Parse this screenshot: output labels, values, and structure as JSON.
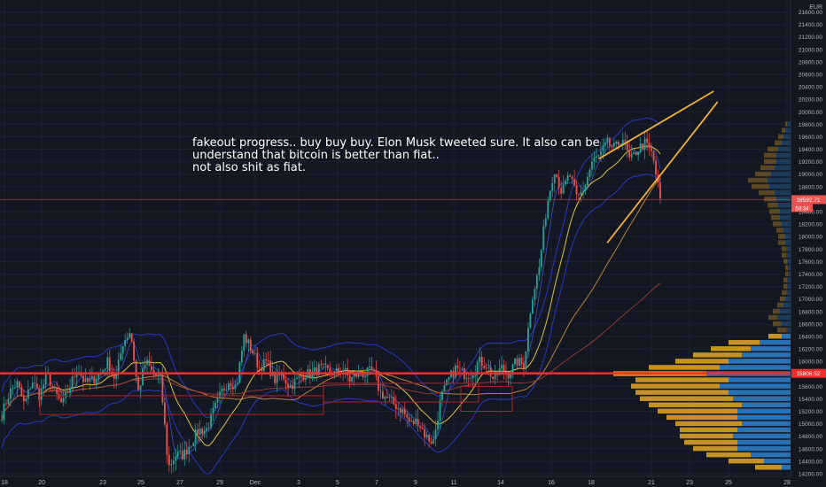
{
  "chart_data": {
    "type": "candlestick",
    "currency": "EUR",
    "y_axis": {
      "min": 14200,
      "max": 21600,
      "ticks": [
        14200,
        14400,
        14600,
        14800,
        15000,
        15200,
        15400,
        15600,
        15800,
        16000,
        16200,
        16400,
        16600,
        16800,
        17000,
        17200,
        17400,
        17600,
        17800,
        18000,
        18200,
        18400,
        18600,
        18800,
        19000,
        19200,
        19400,
        19600,
        19800,
        20000,
        20200,
        20400,
        20600,
        20800,
        21000,
        21200,
        21400,
        21600
      ],
      "tick_labels": [
        "14200.00",
        "14400.00",
        "14600.00",
        "14800.00",
        "15000.00",
        "15200.00",
        "15400.00",
        "15600.00",
        "15800.00",
        "16000.00",
        "16200.00",
        "16400.00",
        "16600.00",
        "16800.00",
        "17000.00",
        "17200.00",
        "17400.00",
        "17600.00",
        "17800.00",
        "18000.00",
        "18200.00",
        "18400.00",
        "18600.00",
        "18800.00",
        "19000.00",
        "19200.00",
        "19400.00",
        "19600.00",
        "19800.00",
        "20000.00",
        "20200.00",
        "20400.00",
        "20600.00",
        "20800.00",
        "21000.00",
        "21200.00",
        "21400.00",
        "21600.00"
      ]
    },
    "x_axis": {
      "labels": [
        "18",
        "20",
        "23",
        "25",
        "27",
        "29",
        "Dec",
        "3",
        "5",
        "7",
        "9",
        "11",
        "14",
        "16",
        "18",
        "21",
        "23",
        "25",
        "28"
      ],
      "label_pos": [
        5,
        47,
        116,
        159,
        203,
        248,
        288,
        337,
        381,
        425,
        469,
        512,
        565,
        622,
        667,
        735,
        778,
        822,
        888
      ]
    },
    "last_price": 18592.71,
    "last_price_label": "18592.71",
    "countdown_label": "59:34",
    "level_price": 15808.52,
    "level_label": "15808.52",
    "price_path": [
      [
        15150,
        15500
      ],
      [
        15650,
        15300
      ],
      [
        15700,
        15450
      ],
      [
        15800,
        15500
      ],
      [
        15300,
        15600
      ],
      [
        15900,
        15650
      ],
      [
        15700,
        15800
      ],
      [
        16000,
        15700
      ],
      [
        16300,
        16500
      ],
      [
        15500,
        16000
      ],
      [
        15800,
        15700
      ],
      [
        14300,
        14500
      ],
      [
        14500,
        14700
      ],
      [
        14900,
        14900
      ],
      [
        15200,
        15500
      ],
      [
        15700,
        15600
      ],
      [
        16400,
        16200
      ],
      [
        15900,
        16000
      ],
      [
        15700,
        15800
      ],
      [
        15600,
        15700
      ],
      [
        15800,
        15800
      ],
      [
        15900,
        15850
      ],
      [
        15800,
        15900
      ],
      [
        15700,
        15800
      ],
      [
        15800,
        15850
      ],
      [
        15500,
        15400
      ],
      [
        15300,
        15200
      ],
      [
        15000,
        15050
      ],
      [
        14800,
        14700
      ],
      [
        15400,
        15700
      ],
      [
        15900,
        15800
      ],
      [
        15800,
        16000
      ],
      [
        15950,
        15700
      ],
      [
        15900,
        15800
      ],
      [
        16000,
        15950
      ],
      [
        17000,
        17500
      ],
      [
        18500,
        19100
      ],
      [
        18700,
        19000
      ],
      [
        18600,
        18800
      ],
      [
        19200,
        19300
      ],
      [
        19500,
        19400
      ],
      [
        19600,
        19200
      ],
      [
        19400,
        19500
      ],
      [
        19300,
        18600
      ]
    ],
    "channel": {
      "upper": [
        [
          18.4,
          19250
        ],
        [
          24.1,
          20330
        ]
      ],
      "lower": [
        [
          18.8,
          17900
        ],
        [
          24.3,
          20160
        ]
      ]
    },
    "annotation": [
      "fakeout progress.. buy buy buy. Elon Musk tweeted sure. It also can be",
      "understand that bitcoin is better than fiat..",
      "not also shit as fiat."
    ],
    "colors": {
      "background": "#131722",
      "up": "#26a69a",
      "down": "#ef5350",
      "level": "#ff2a2a",
      "channel": "#f5b133",
      "band": "#2b3cd6",
      "vp_up": "#2b7bc4",
      "vp_down": "#d9a023"
    }
  }
}
